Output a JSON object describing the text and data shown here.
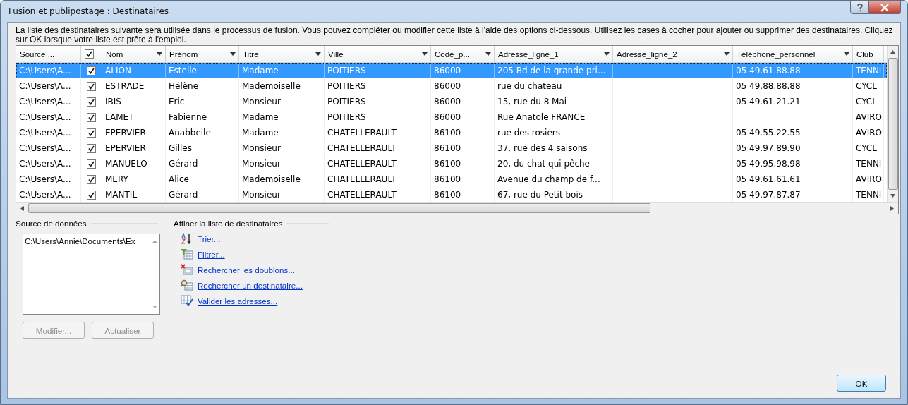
{
  "window": {
    "title": "Fusion et publipostage : Destinataires"
  },
  "intro": "La liste des destinataires suivante sera utilisée dans le processus de fusion. Vous pouvez compléter ou modifier cette liste à l'aide des options ci-dessous. Utilisez les cases à cocher pour ajouter ou supprimer des destinataires. Cliquez sur OK lorsque votre liste est prête à l'emploi.",
  "table": {
    "header_checkbox": {
      "checked": true
    },
    "columns": [
      {
        "kind": "text",
        "label": "Source ..."
      },
      {
        "kind": "check"
      },
      {
        "kind": "text",
        "label": "Nom",
        "dropdown": true
      },
      {
        "kind": "text",
        "label": "Prénom",
        "dropdown": true
      },
      {
        "kind": "text",
        "label": "Titre",
        "dropdown": true
      },
      {
        "kind": "text",
        "label": "Ville",
        "dropdown": true
      },
      {
        "kind": "text",
        "label": "Code_p...",
        "dropdown": true
      },
      {
        "kind": "text",
        "label": "Adresse_ligne_1",
        "dropdown": true
      },
      {
        "kind": "text",
        "label": "Adresse_ligne_2",
        "dropdown": true
      },
      {
        "kind": "text",
        "label": "Téléphone_personnel",
        "dropdown": true
      },
      {
        "kind": "text",
        "label": "Club"
      }
    ],
    "rows": [
      {
        "selected": true,
        "checked": true,
        "cells": [
          "C:\\Users\\A...",
          "",
          "ALION",
          "Estelle",
          "Madame",
          "POITIERS",
          "86000",
          "205 Bd de la grande pri...",
          "",
          "05 49.61.88.88",
          "TENNI"
        ]
      },
      {
        "selected": false,
        "checked": true,
        "cells": [
          "C:\\Users\\A...",
          "",
          "ESTRADE",
          "Hélène",
          "Mademoiselle",
          "POITIERS",
          "86000",
          "rue du chateau",
          "",
          "05 49.88.88.88",
          "CYCL"
        ]
      },
      {
        "selected": false,
        "checked": true,
        "cells": [
          "C:\\Users\\A...",
          "",
          "IBIS",
          "Eric",
          "Monsieur",
          "POITIERS",
          "86000",
          "15, rue du 8 Mai",
          "",
          "05 49.61.21.21",
          "CYCL"
        ]
      },
      {
        "selected": false,
        "checked": true,
        "cells": [
          "C:\\Users\\A...",
          "",
          "LAMET",
          "Fabienne",
          "Madame",
          "POITIERS",
          "86000",
          "Rue Anatole FRANCE",
          "",
          "",
          "AVIRO"
        ]
      },
      {
        "selected": false,
        "checked": true,
        "cells": [
          "C:\\Users\\A...",
          "",
          "EPERVIER",
          "Anabbelle",
          "Madame",
          "CHATELLERAULT",
          "86100",
          "rue des rosiers",
          "",
          "05 49.55.22.55",
          "AVIRO"
        ]
      },
      {
        "selected": false,
        "checked": true,
        "cells": [
          "C:\\Users\\A...",
          "",
          "EPERVIER",
          "Gilles",
          "Monsieur",
          "CHATELLERAULT",
          "86100",
          "37, rue des 4 saisons",
          "",
          "05 49.97.89.90",
          "CYCL"
        ]
      },
      {
        "selected": false,
        "checked": true,
        "cells": [
          "C:\\Users\\A...",
          "",
          "MANUELO",
          "Gérard",
          "Monsieur",
          "CHATELLERAULT",
          "86100",
          "20, du chat qui pêche",
          "",
          "05 49.95.98.98",
          "TENNI"
        ]
      },
      {
        "selected": false,
        "checked": true,
        "cells": [
          "C:\\Users\\A...",
          "",
          "MERY",
          "Alice",
          "Mademoiselle",
          "CHATELLERAULT",
          "86100",
          "Avenue du champ de f...",
          "",
          "05 49.61.61.61",
          "AVIRO"
        ]
      },
      {
        "selected": false,
        "checked": true,
        "cells": [
          "C:\\Users\\A...",
          "",
          "MANTIL",
          "Gérard",
          "Monsieur",
          "CHATELLERAULT",
          "86100",
          "67, rue du Petit bois",
          "",
          "05 49.97.87.87",
          "TENNI"
        ]
      }
    ]
  },
  "data_source": {
    "label": "Source de données",
    "items": [
      "C:\\Users\\Annie\\Documents\\Ex"
    ],
    "buttons": [
      {
        "label": "Modifier...",
        "disabled": true
      },
      {
        "label": "Actualiser",
        "disabled": true
      }
    ]
  },
  "refine": {
    "label": "Affiner la liste de destinataires",
    "links": [
      {
        "kind": "sort",
        "label": "Trier..."
      },
      {
        "kind": "filter",
        "label": "Filtrer..."
      },
      {
        "kind": "duplicates",
        "label": "Rechercher les doublons..."
      },
      {
        "kind": "find",
        "label": "Rechercher un destinataire..."
      },
      {
        "kind": "validate",
        "label": "Valider les adresses..."
      }
    ]
  },
  "ok_button": {
    "label": "OK"
  }
}
